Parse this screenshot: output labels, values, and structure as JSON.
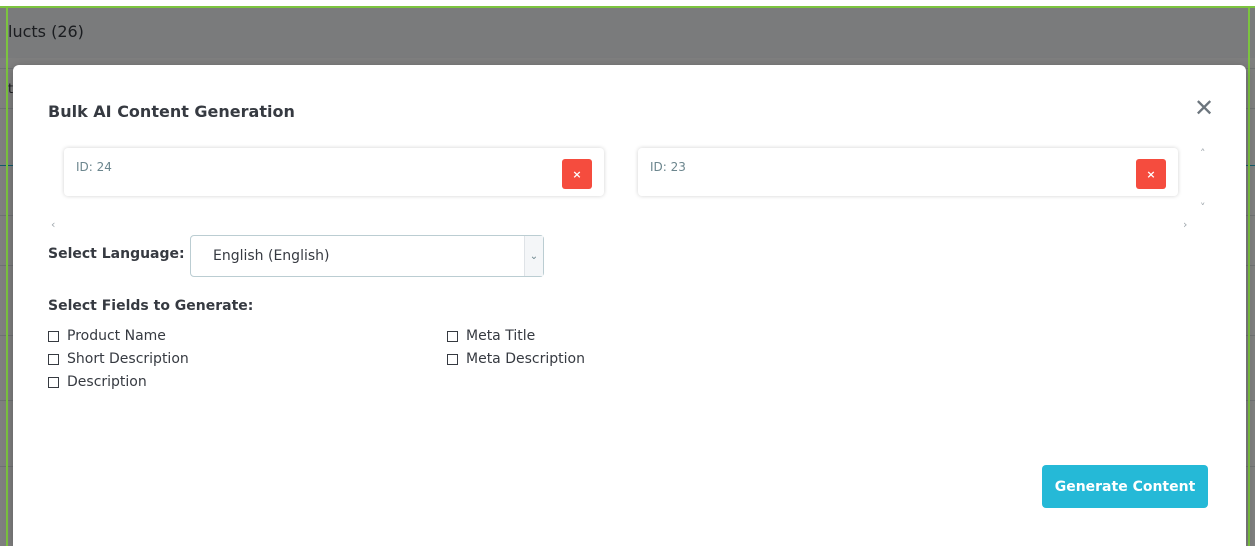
{
  "background": {
    "title": "lucts (26)",
    "truncated_cell": "t"
  },
  "modal": {
    "title": "Bulk AI Content Generation",
    "close_icon": "close-icon",
    "selected_items": [
      {
        "label": "ID: 24",
        "remove_label": "×"
      },
      {
        "label": "ID: 23",
        "remove_label": "×"
      }
    ],
    "scroll": {
      "up": "˄",
      "down": "˅",
      "left": "‹",
      "right": "›"
    },
    "language": {
      "label": "Select Language:",
      "selected": "English (English)",
      "chevron": "⌄"
    },
    "fields": {
      "label": "Select Fields to Generate:",
      "options": [
        {
          "label": "Product Name",
          "checked": false
        },
        {
          "label": "Short Description",
          "checked": false
        },
        {
          "label": "Description",
          "checked": false
        },
        {
          "label": "Meta Title",
          "checked": false
        },
        {
          "label": "Meta Description",
          "checked": false
        }
      ]
    },
    "generate_button": "Generate Content"
  },
  "colors": {
    "accent": "#25b9d7",
    "danger": "#f54c3e",
    "frame": "#7cc43f"
  }
}
